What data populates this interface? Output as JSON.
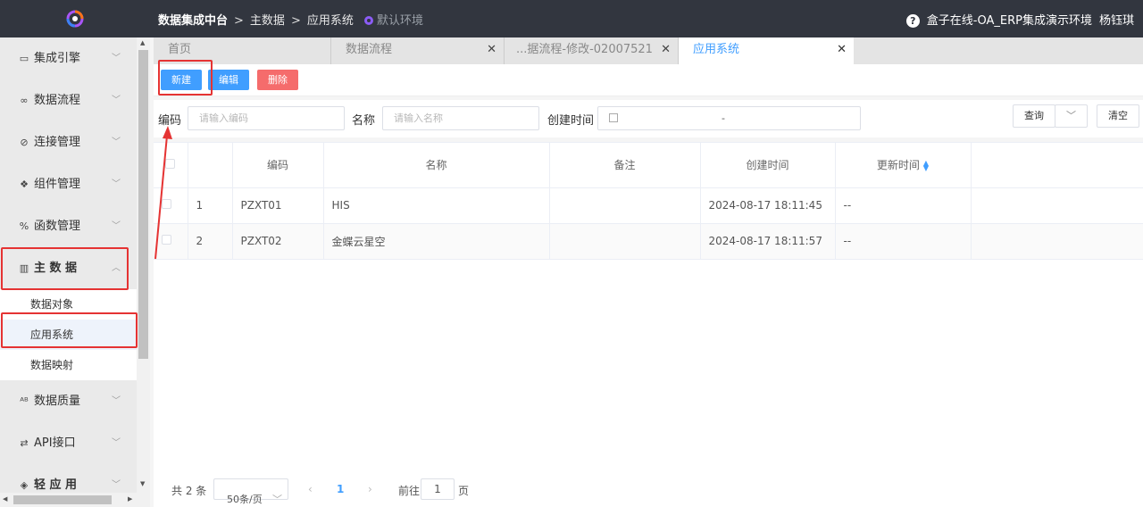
{
  "topbar": {
    "breadcrumb_root": "数据集成中台",
    "breadcrumb_sep": ">",
    "breadcrumb_1": "主数据",
    "breadcrumb_2": "应用系统",
    "env": "默认环境",
    "help": "?",
    "tenant": "盒子在线-OA_ERP集成演示环境",
    "user": "杨钰琪"
  },
  "sidebar": {
    "items": [
      {
        "label": "集成引擎",
        "icon": "monitor-icon"
      },
      {
        "label": "数据流程",
        "icon": "infinity-icon"
      },
      {
        "label": "连接管理",
        "icon": "link-icon"
      },
      {
        "label": "组件管理",
        "icon": "components-icon"
      },
      {
        "label": "函数管理",
        "icon": "percent-icon"
      },
      {
        "label": "主 数 据",
        "icon": "map-icon"
      }
    ],
    "subitems": [
      {
        "label": "数据对象"
      },
      {
        "label": "应用系统"
      },
      {
        "label": "数据映射"
      }
    ],
    "items_after": [
      {
        "label": "数据质量",
        "icon": "abc-icon"
      },
      {
        "label": "API接口",
        "icon": "swap-icon"
      },
      {
        "label": "轻 应 用",
        "icon": "cube-icon"
      }
    ]
  },
  "tabs": [
    {
      "label": "首页"
    },
    {
      "label": "数据流程"
    },
    {
      "label": "...据流程-修改-02007521"
    },
    {
      "label": "应用系统"
    }
  ],
  "toolbar": {
    "new": "新建",
    "edit": "编辑",
    "delete": "删除"
  },
  "filter": {
    "code_label": "编码",
    "code_placeholder": "请输入编码",
    "name_label": "名称",
    "name_placeholder": "请输入名称",
    "time_label": "创建时间",
    "time_sep": "-",
    "query": "查询",
    "clear": "清空"
  },
  "table": {
    "headers": [
      "编码",
      "名称",
      "备注",
      "创建时间",
      "更新时间"
    ],
    "rows": [
      {
        "index": "1",
        "code": "PZXT01",
        "name": "HIS",
        "remark": "",
        "created": "2024-08-17 18:11:45",
        "updated": "--"
      },
      {
        "index": "2",
        "code": "PZXT02",
        "name": "金蝶云星空",
        "remark": "",
        "created": "2024-08-17 18:11:57",
        "updated": "--"
      }
    ]
  },
  "pager": {
    "total": "共 2 条",
    "page_size": "50条/页",
    "current": "1",
    "goto_label": "前往",
    "goto_value": "1",
    "page_unit": "页"
  },
  "colors": {
    "topbar": "#32363f",
    "primary": "#409eff",
    "danger": "#f56c6c",
    "annotation": "#e53333"
  }
}
